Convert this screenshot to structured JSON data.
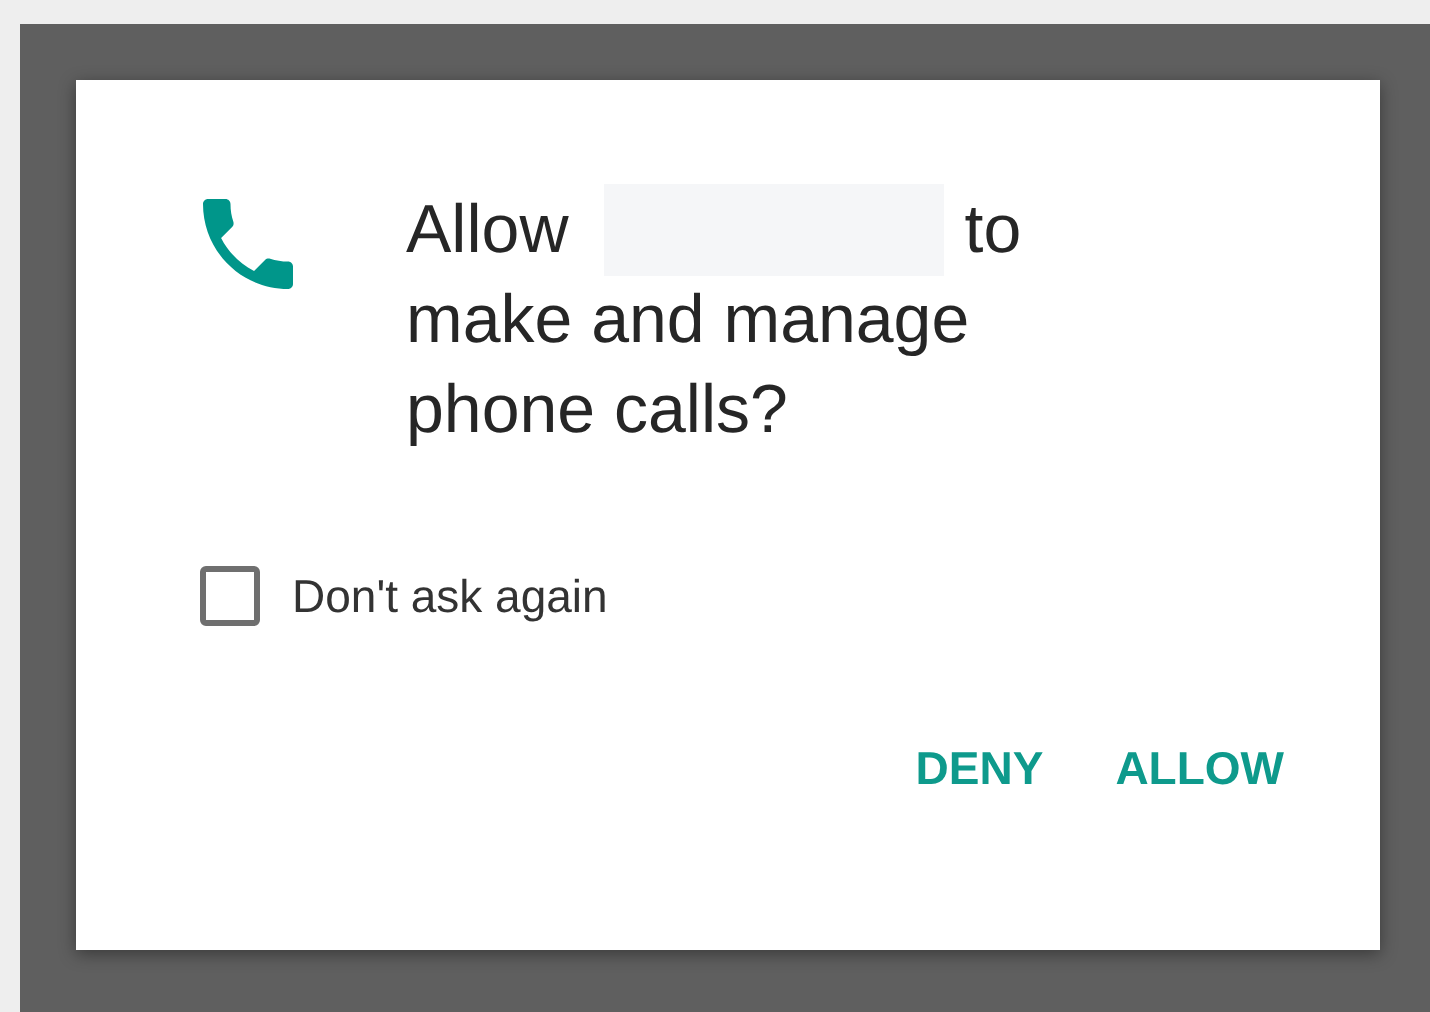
{
  "dialog": {
    "title_before": "Allow",
    "title_after": "to make and manage phone calls?",
    "checkbox": {
      "label": "Don't ask again",
      "checked": false
    },
    "buttons": [
      "DENY",
      "ALLOW"
    ]
  }
}
